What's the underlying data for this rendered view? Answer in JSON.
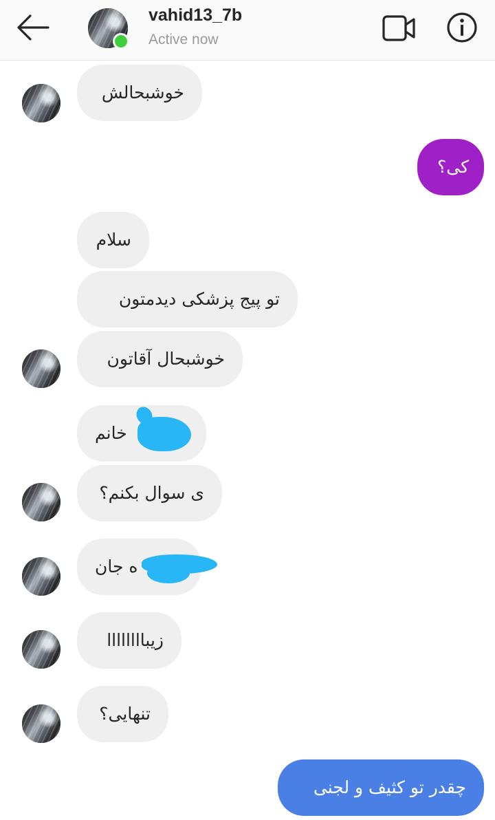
{
  "header": {
    "username": "vahid13_7b",
    "status": "Active now",
    "icons": {
      "back": "arrow-left-icon",
      "video": "video-camera-icon",
      "info": "info-icon"
    }
  },
  "colors": {
    "received_bubble": "#efefef",
    "sent_bubble_purple": "#a020c8",
    "sent_bubble_blue": "#4a7fe6",
    "online_indicator": "#3ecf3a",
    "redaction": "#29b6f6"
  },
  "messages": [
    {
      "from": "them",
      "text": "خوشبحالش"
    },
    {
      "from": "me",
      "text": "کی؟"
    },
    {
      "from": "them",
      "text": "سلام"
    },
    {
      "from": "them",
      "text": "تو پیج پزشکی دیدمتون"
    },
    {
      "from": "them",
      "text": "خوشبحال آقاتون"
    },
    {
      "from": "them",
      "text": "خانم"
    },
    {
      "from": "them",
      "text": "ی سوال بکنم؟"
    },
    {
      "from": "them",
      "text": "ه جان"
    },
    {
      "from": "them",
      "text": "زیباااااااا"
    },
    {
      "from": "them",
      "text": "تنهایی؟"
    },
    {
      "from": "me",
      "text": "چقدر تو کثیف و لجنی"
    }
  ]
}
